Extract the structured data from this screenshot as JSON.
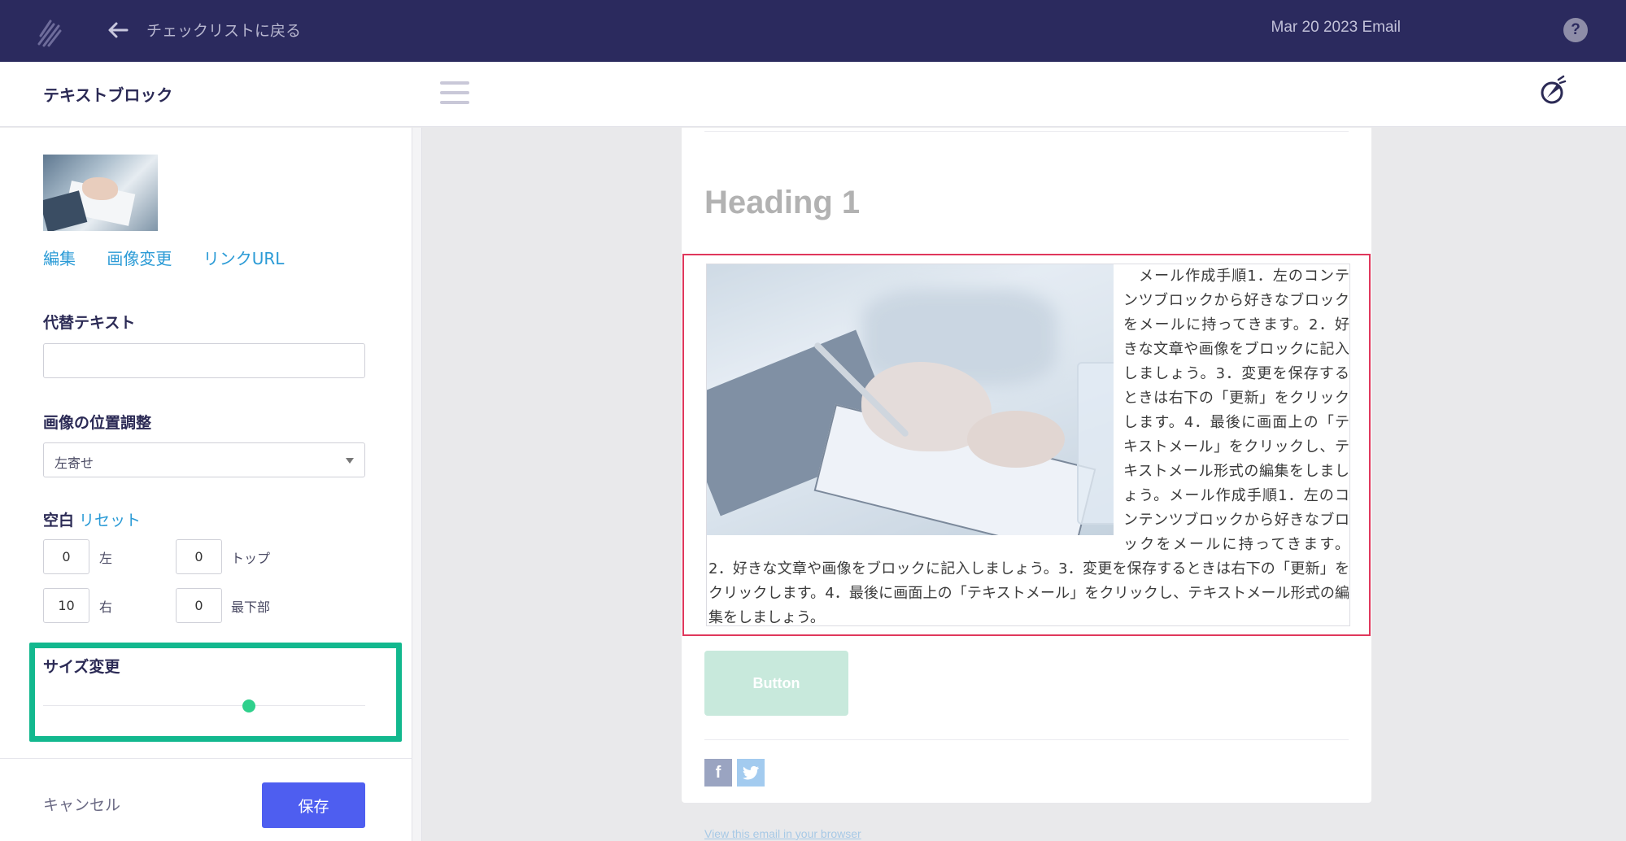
{
  "topbar": {
    "back_label": "チェックリストに戻る",
    "campaign_title": "Mar 20 2023 Email",
    "help_label": "?"
  },
  "header": {
    "panel_title": "テキストブロック"
  },
  "sidebar": {
    "image_links": {
      "edit": "編集",
      "change": "画像変更",
      "link_url": "リンクURL"
    },
    "alt_text": {
      "label": "代替テキスト",
      "value": ""
    },
    "position": {
      "label": "画像の位置調整",
      "selected": "左寄せ"
    },
    "spacing": {
      "label": "空白",
      "reset": "リセット",
      "left_value": "0",
      "left_label": "左",
      "top_value": "0",
      "top_label": "トップ",
      "right_value": "10",
      "right_label": "右",
      "bottom_value": "0",
      "bottom_label": "最下部"
    },
    "resize": {
      "label": "サイズ変更",
      "value": 0.64
    },
    "cancel_label": "キャンセル",
    "save_label": "保存"
  },
  "email": {
    "heading": "Heading 1",
    "body_text": "　メール作成手順1．左のコンテンツブロックから好きなブロックをメールに持ってきます。2．好きな文章や画像をブロックに記入しましょう。3．変更を保存するときは右下の「更新」をクリックします。4．最後に画面上の「テキストメール」をクリックし、テキストメール形式の編集をしましょう。メール作成手順1．左のコンテンツブロックから好きなブロックをメールに持ってきます。2．好きな文章や画像をブロックに記入しましょう。3．変更を保存するときは右下の「更新」をクリックします。4．最後に画面上の「テキストメール」をクリックし、テキストメール形式の編集をしましょう。",
    "button_label": "Button",
    "facebook_label": "f",
    "view_in_browser": "View this email in your browser"
  },
  "colors": {
    "topbar": "#2b2a5e",
    "accent_link": "#2b9bd6",
    "save_button": "#4e5ef0",
    "highlight": "#12b88e",
    "selection": "#e0375c",
    "slider": "#2fd08c"
  }
}
